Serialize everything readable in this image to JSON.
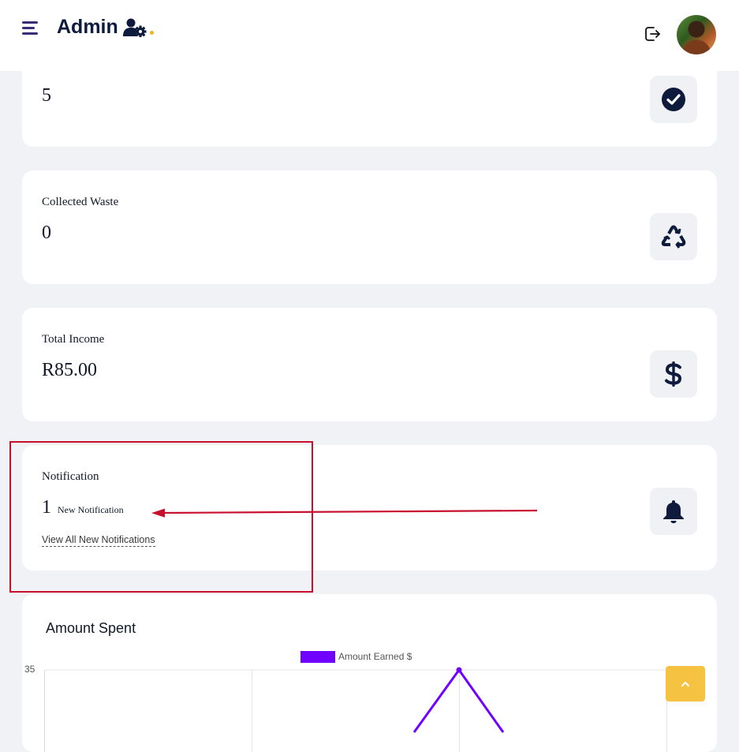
{
  "header": {
    "brand": "Admin",
    "icons": {
      "menu": "hamburger-menu-icon",
      "brand": "user-gear-icon",
      "logout": "logout-icon",
      "avatar": "user-avatar"
    },
    "brand_dot_color": "#f5b31c"
  },
  "cards": {
    "first": {
      "value": "5",
      "icon": "check-circle-icon"
    },
    "collected": {
      "label": "Collected Waste",
      "value": "0",
      "icon": "recycle-icon"
    },
    "income": {
      "label": "Total Income",
      "value": "R85.00",
      "icon": "dollar-icon"
    },
    "notification": {
      "label": "Notification",
      "count": "1",
      "count_label": "New Notification",
      "link": "View All New Notifications",
      "icon": "bell-icon"
    }
  },
  "annotation": {
    "color": "#c8102e"
  },
  "chart": {
    "title": "Amount Spent"
  },
  "chart_data": {
    "type": "line",
    "series": [
      {
        "name": "Amount Earned $",
        "color": "#7000ff"
      }
    ],
    "y_tick_labels": [
      "35"
    ],
    "peak_value": 35,
    "legend": "top-center",
    "grid": true
  },
  "scroll_top": {
    "icon": "chevron-up-icon",
    "color": "#f6c242"
  }
}
